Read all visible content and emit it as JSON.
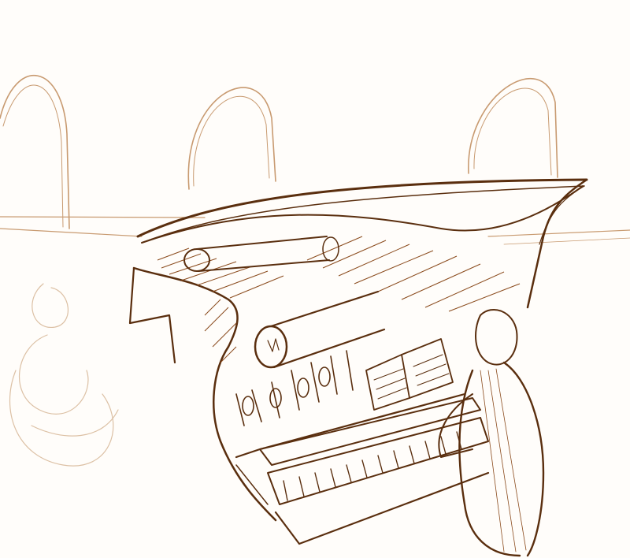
{
  "image": {
    "colors": {
      "paper": "#fffdfa",
      "ink_dark": "#5a2e0e",
      "ink_mid": "#8a4a1c",
      "ink_light": "#c89a70",
      "ink_faint": "#dcc0a4"
    }
  }
}
